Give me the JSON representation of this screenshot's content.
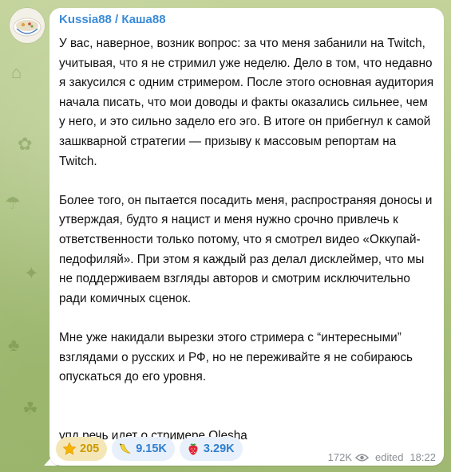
{
  "post": {
    "author": "Kussia88 / Каша88",
    "paragraphs": [
      "У вас, наверное, возник вопрос: за что меня забанили на Twitch, учитывая, что я не стримил уже неделю. Дело в том, что недавно я закусился с одним стримером. После этого основная аудитория начала писать, что мои доводы и факты оказались сильнее, чем у него, и это сильно задело его эго. В итоге он прибегнул к самой зашкварной стратегии — призыву к массовым репортам на Twitch.",
      "Более того, он пытается посадить меня, распространяя доносы и утверждая, будто я нацист и меня нужно срочно привлечь к ответственности только потому, что я смотрел видео «Оккупай-педофиляй». При этом я каждый раз делал дисклеймер, что мы не поддерживаем взгляды авторов и смотрим исключительно ради комичных сценок.",
      "Мне уже накидали вырезки этого стримера с “интересными” взглядами о русских и РФ, но не переживайте я не собираюсь опускаться до его уровня.",
      "упд речь идет о стримере Olesha"
    ],
    "reactions": [
      {
        "emoji": "star-icon",
        "count": "205",
        "chosen": true
      },
      {
        "emoji": "banana-icon",
        "count": "9.15K",
        "chosen": false
      },
      {
        "emoji": "strawberry-icon",
        "count": "3.29K",
        "chosen": false
      }
    ],
    "views": "172K",
    "edited_label": "edited",
    "time": "18:22"
  },
  "colors": {
    "author": "#3a8bd8",
    "reaction_bg": "#e8f0fb",
    "reaction_text": "#2e7fd0",
    "chosen_bg": "#f5e6b8",
    "chosen_text": "#c99a00"
  }
}
